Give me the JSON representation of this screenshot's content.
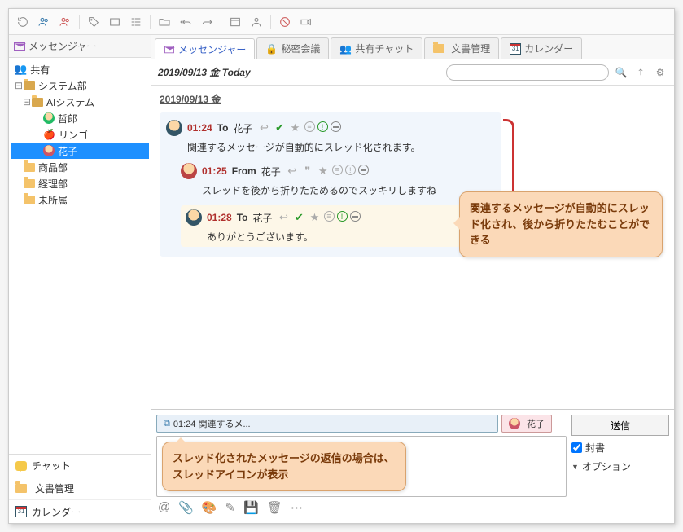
{
  "sidebar": {
    "header": "メッセンジャー",
    "share_label": "共有",
    "nodes": {
      "system": "システム部",
      "aisystem": "AIシステム",
      "tetsuro": "哲郎",
      "ringo": "リンゴ",
      "hanako": "花子",
      "shohin": "商品部",
      "keiri": "経理部",
      "mishozoku": "未所属"
    },
    "bottom": {
      "chat": "チャット",
      "docs": "文書管理",
      "calendar": "カレンダー",
      "cal_day": "31"
    }
  },
  "tabs": {
    "messenger": "メッセンジャー",
    "secret": "秘密会議",
    "shared": "共有チャット",
    "docs": "文書管理",
    "calendar": "カレンダー",
    "cal_day": "31"
  },
  "datebar": {
    "title": "2019/09/13 金 Today"
  },
  "day_header": "2019/09/13 金",
  "messages": [
    {
      "time": "01:24",
      "dir": "To",
      "peer": "花子",
      "body": "関連するメッセージが自動的にスレッド化されます。"
    },
    {
      "time": "01:25",
      "dir": "From",
      "peer": "花子",
      "body": "スレッドを後から折りたためるのでスッキリしますね"
    },
    {
      "time": "01:28",
      "dir": "To",
      "peer": "花子",
      "body": "ありがとうございます。"
    }
  ],
  "callout1": "関連するメッセージが自動的にスレッド化され、後から折りたたむことができる",
  "compose": {
    "thread_tab": "01:24 関連するメ...",
    "user_tab": "花子",
    "callout2": "スレッド化されたメッセージの返信の場合は、スレッドアイコンが表示",
    "send": "送信",
    "sealed": "封書",
    "options": "オプション"
  }
}
